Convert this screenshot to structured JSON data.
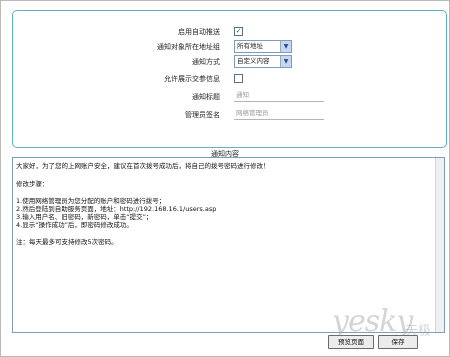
{
  "settings": {
    "enable_auto_push": {
      "label": "启用自动推送",
      "checked": true
    },
    "target_group": {
      "label": "通知对象所在地址组",
      "value": "所有地址"
    },
    "notice_mode": {
      "label": "通知方式",
      "value": "自定义内容"
    },
    "allow_reply": {
      "label": "允许展示交参信息",
      "checked": false
    },
    "notice_title": {
      "label": "通知标题",
      "placeholder": "通知"
    },
    "admin_signature": {
      "label": "管理员签名",
      "placeholder": "网络管理员"
    }
  },
  "content": {
    "title": "通知内容",
    "lines": [
      "大家好，为了您的上网账户安全，建议在首次拨号成功后，将自己的拨号密码进行修改！",
      "",
      "修改步骤：",
      "",
      "1.使用网络管理员为您分配的账户和密码进行拨号；",
      "2.然后登陆到自助服务页面，地址：http://192.168.16.1/users.asp",
      "3.输入用户名、旧密码，新密码，单击“提交”；",
      "4.显示“操作成功”后，即密码修改成功。",
      "",
      "注：每天最多可支持修改5次密码。"
    ]
  },
  "buttons": {
    "preview": "预览页面",
    "save": "保存"
  },
  "watermark": {
    "logo": "yesky",
    "sub": "天极"
  },
  "icons": {
    "check": "check-icon",
    "dropdown": "chevron-down-icon"
  },
  "colors": {
    "panel_border": "#5fb0c8",
    "input_border": "#7f9db9",
    "check": "#2a6a2a"
  }
}
